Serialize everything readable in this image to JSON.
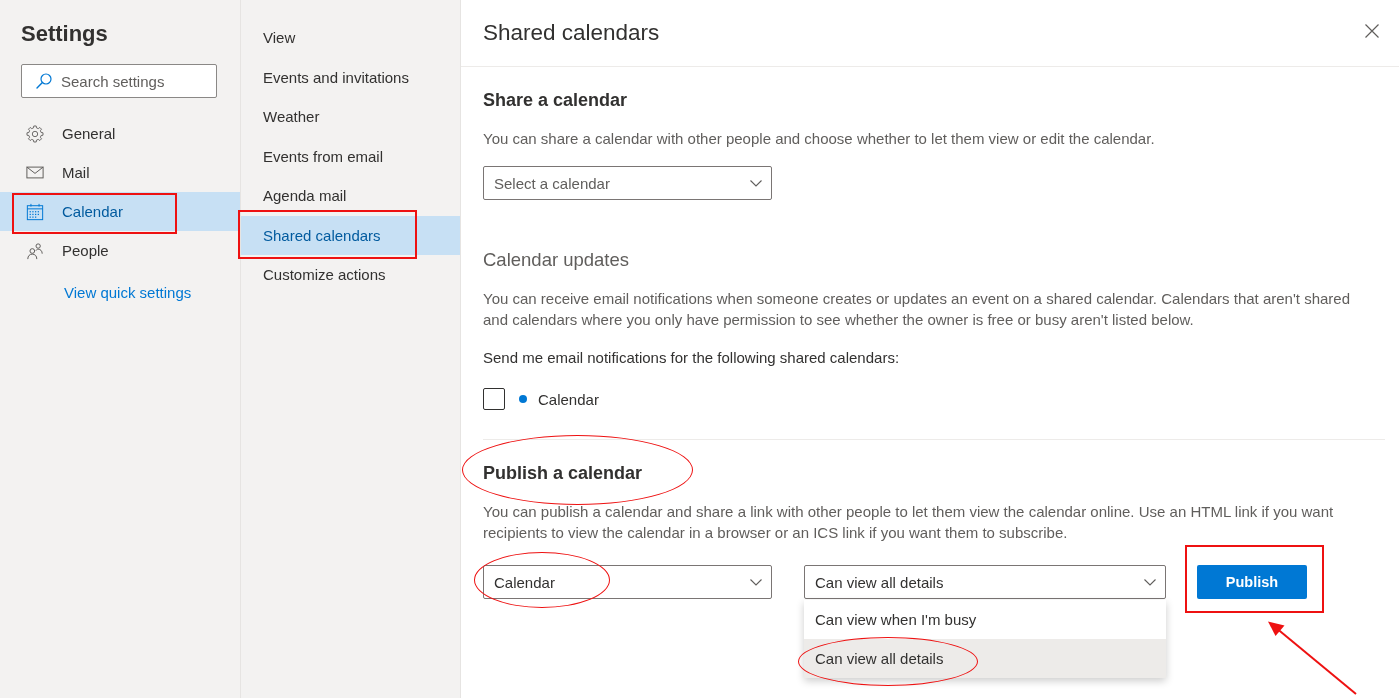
{
  "sidebar": {
    "title": "Settings",
    "search": {
      "placeholder": "Search settings"
    },
    "items": [
      {
        "label": "General",
        "selected": false,
        "boxed": false
      },
      {
        "label": "Mail",
        "selected": false,
        "boxed": false
      },
      {
        "label": "Calendar",
        "selected": true,
        "boxed": true
      },
      {
        "label": "People",
        "selected": false,
        "boxed": false
      }
    ],
    "link": "View quick settings"
  },
  "subnav": {
    "items": [
      {
        "label": "View",
        "selected": false,
        "boxed": false
      },
      {
        "label": "Events and invitations",
        "selected": false,
        "boxed": false
      },
      {
        "label": "Weather",
        "selected": false,
        "boxed": false
      },
      {
        "label": "Events from email",
        "selected": false,
        "boxed": false
      },
      {
        "label": "Agenda mail",
        "selected": false,
        "boxed": false
      },
      {
        "label": "Shared calendars",
        "selected": true,
        "boxed": true
      },
      {
        "label": "Customize actions",
        "selected": false,
        "boxed": false
      }
    ]
  },
  "panel": {
    "title": "Shared calendars"
  },
  "share": {
    "heading": "Share a calendar",
    "description": "You can share a calendar with other people and choose whether to let them view or edit the calendar.",
    "calendar_select": {
      "placeholder": "Select a calendar"
    }
  },
  "updates": {
    "heading": "Calendar updates",
    "description": "You can receive email notifications when someone creates or updates an event on a shared calendar. Calendars that aren't shared and calendars where you only have permission to see whether the owner is free or busy aren't listed below.",
    "prompt": "Send me email notifications for the following shared calendars:",
    "calendars": [
      {
        "name": "Calendar",
        "checked": false,
        "color": "#0078d4"
      }
    ]
  },
  "publish": {
    "heading": "Publish a calendar",
    "heading_circled": true,
    "description": "You can publish a calendar and share a link with other people to let them view the calendar online. Use an HTML link if you want recipients to view the calendar in a browser or an ICS link if you want them to subscribe.",
    "calendar_select": {
      "value": "Calendar",
      "circled": true
    },
    "permission_select": {
      "value": "Can view all details",
      "expanded": true,
      "options": [
        {
          "label": "Can view when I'm busy",
          "selected": false,
          "circled": false
        },
        {
          "label": "Can view all details",
          "selected": true,
          "circled": true
        }
      ]
    },
    "publish_button": {
      "label": "Publish",
      "boxed": true,
      "arrow": true
    }
  }
}
